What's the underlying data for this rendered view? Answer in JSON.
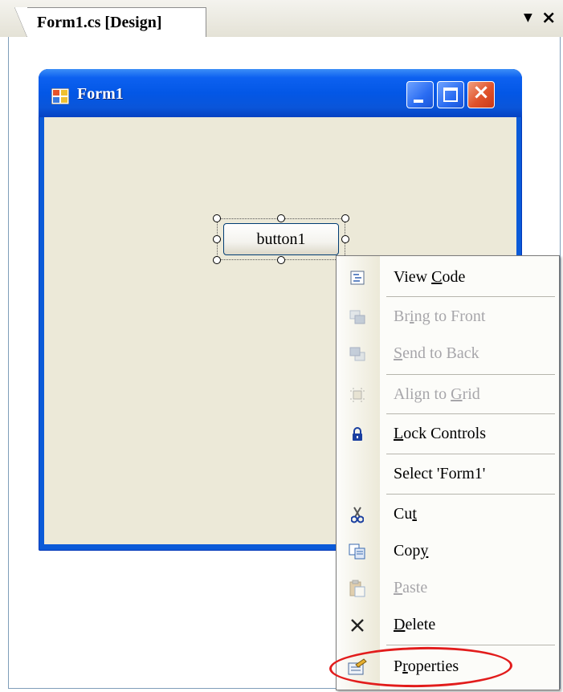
{
  "tab": {
    "title": "Form1.cs [Design]",
    "dropdown_icon": "chevron-down-icon",
    "close_icon": "close-icon"
  },
  "form": {
    "title": "Form1",
    "caption_buttons": [
      "minimize",
      "maximize",
      "close"
    ],
    "titlebar_color": "#0a5ad8",
    "client_color": "#ece9d8"
  },
  "button1": {
    "label": "button1",
    "selected": true
  },
  "context_menu": {
    "items": [
      {
        "icon": "view-code-icon",
        "pre": "View ",
        "acc": "C",
        "post": "ode",
        "enabled": true
      },
      {
        "icon": "bring-to-front-icon",
        "pre": "Br",
        "acc": "i",
        "post": "ng to Front",
        "enabled": false
      },
      {
        "icon": "send-to-back-icon",
        "pre": "",
        "acc": "S",
        "post": "end to Back",
        "enabled": false
      },
      {
        "icon": "align-to-grid-icon",
        "pre": "Align to ",
        "acc": "G",
        "post": "rid",
        "enabled": false
      },
      {
        "icon": "lock-icon",
        "pre": "",
        "acc": "L",
        "post": "ock Controls",
        "enabled": true
      },
      {
        "icon": "",
        "pre": "Select 'Form1'",
        "acc": "",
        "post": "",
        "enabled": true
      },
      {
        "icon": "scissors-icon",
        "pre": "Cu",
        "acc": "t",
        "post": "",
        "enabled": true
      },
      {
        "icon": "copy-icon",
        "pre": "Cop",
        "acc": "y",
        "post": "",
        "enabled": true
      },
      {
        "icon": "paste-icon",
        "pre": "",
        "acc": "P",
        "post": "aste",
        "enabled": false
      },
      {
        "icon": "delete-x-icon",
        "pre": "",
        "acc": "D",
        "post": "elete",
        "enabled": true
      },
      {
        "icon": "properties-icon",
        "pre": "P",
        "acc": "r",
        "post": "operties",
        "enabled": true
      }
    ],
    "highlighted_item": "Properties",
    "highlight_color": "#e21c1c"
  }
}
